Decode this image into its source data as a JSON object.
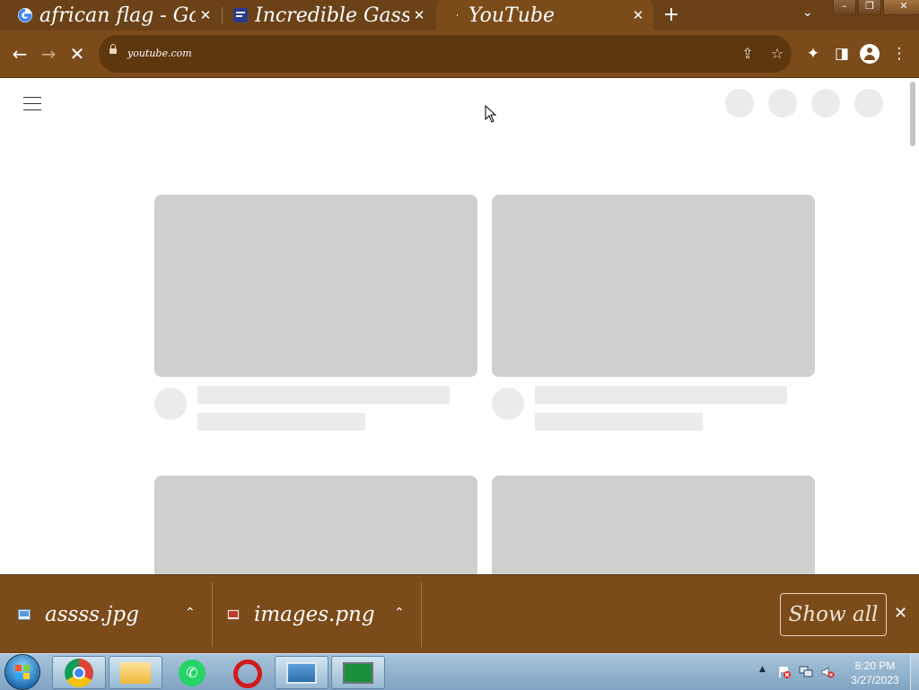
{
  "tabs": [
    {
      "title": "african flag - Go",
      "favicon": "google-icon"
    },
    {
      "title": "Incredible Gassy",
      "favicon": "site-icon"
    },
    {
      "title": "YouTube",
      "favicon": "youtube-icon",
      "active": true
    }
  ],
  "tab_close_glyph": "✕",
  "new_tab_glyph": "+",
  "tab_search_glyph": "⌄",
  "window_buttons": {
    "minimize": "–",
    "restore": "❐",
    "close": "✕"
  },
  "toolbar": {
    "back_glyph": "←",
    "forward_glyph": "→",
    "stop_glyph": "✕",
    "url": "youtube.com",
    "share_glyph": "⇪",
    "bookmark_glyph": "☆",
    "extensions_glyph": "✦",
    "sidepanel_glyph": "◨",
    "menu_glyph": "⋮"
  },
  "downloads": {
    "items": [
      {
        "name": "assss.jpg",
        "icon": "image-file-icon"
      },
      {
        "name": "images.png",
        "icon": "png-file-icon"
      }
    ],
    "chevron_glyph": "⌃",
    "show_all_label": "Show all",
    "close_glyph": "✕"
  },
  "taskbar": {
    "apps": [
      "chrome-icon",
      "file-explorer-icon",
      "whatsapp-icon",
      "opera-icon",
      "photo-viewer-icon",
      "system-monitor-icon"
    ],
    "whatsapp_glyph": "✆",
    "tray_arrow_glyph": "▲",
    "time": "8:20 PM",
    "date": "3/27/2023"
  },
  "colors": {
    "theme_brown": "#7b4b1a",
    "tabstrip_brown": "#6b4218",
    "skeleton_thumb": "#cfcfcf",
    "skeleton_light": "#ebebeb"
  }
}
